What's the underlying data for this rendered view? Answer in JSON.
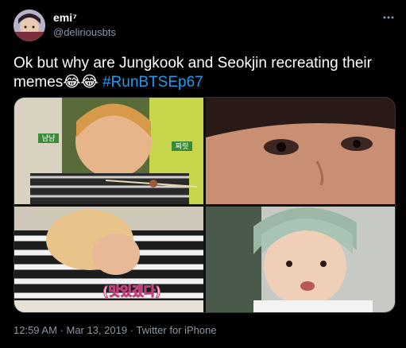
{
  "tweet": {
    "display_name": "emi⁷",
    "handle": "@deliriousbts",
    "text_plain": "Ok but why are Jungkook and Seokjin recreating their memes",
    "emoji": "😂😂",
    "hashtag": "#RunBTSEp67",
    "time": "12:59 AM",
    "separator": " · ",
    "date": "Mar 13, 2019",
    "source": "Twitter for iPhone"
  },
  "media": {
    "caption_korean": "(맛있겠다)",
    "sign_korean_left": "냠냠",
    "sign_korean_right": "찌릿"
  },
  "icons": {
    "more": "more-horizontal-icon"
  },
  "colors": {
    "background": "#000000",
    "text": "#ffffff",
    "secondary_text": "#8b98a5",
    "link": "#1d9bf0",
    "border": "#2f3336"
  }
}
